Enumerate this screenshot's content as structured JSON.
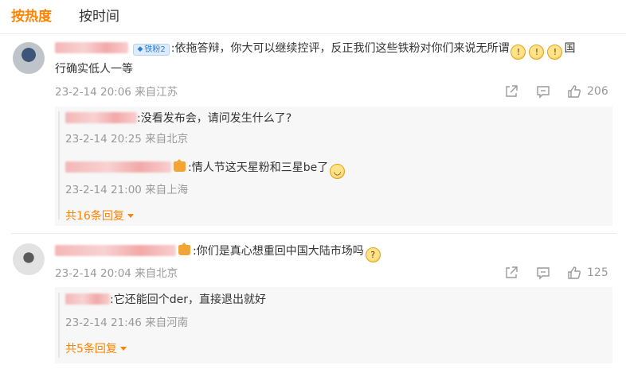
{
  "tabs": [
    {
      "label": "按热度",
      "active": true
    },
    {
      "label": "按时间",
      "active": false
    }
  ],
  "colors": {
    "accent": "#ff8200",
    "meta": "#999999",
    "text": "#333333"
  },
  "comments": [
    {
      "badge": "铁粉2",
      "text": ":依拖答辩，你大可以继续控评，反正我们这些铁粉对你们来说无所谓",
      "emojis": [
        "scream-emoji",
        "scream-emoji",
        "scream-emoji"
      ],
      "text_tail_1": "国",
      "text_line2": "行确实低人一等",
      "time": "23-2-14 20:06",
      "location": "来自江苏",
      "likes": "206",
      "replies": [
        {
          "text": ":没看发布会，请问发生什么了?",
          "time": "23-2-14 20:25",
          "location": "来自北京"
        },
        {
          "text": ":情人节这天星粉和三星be了",
          "time": "23-2-14 21:00",
          "location": "来自上海"
        }
      ],
      "more_replies": "共16条回复"
    },
    {
      "text": ":你们是真心想重回中国大陆市场吗",
      "time": "23-2-14 20:04",
      "location": "来自北京",
      "likes": "125",
      "replies": [
        {
          "text": ":它还能回个der，直接退出就好",
          "time": "23-2-14 21:46",
          "location": "来自河南"
        }
      ],
      "more_replies": "共5条回复"
    }
  ]
}
